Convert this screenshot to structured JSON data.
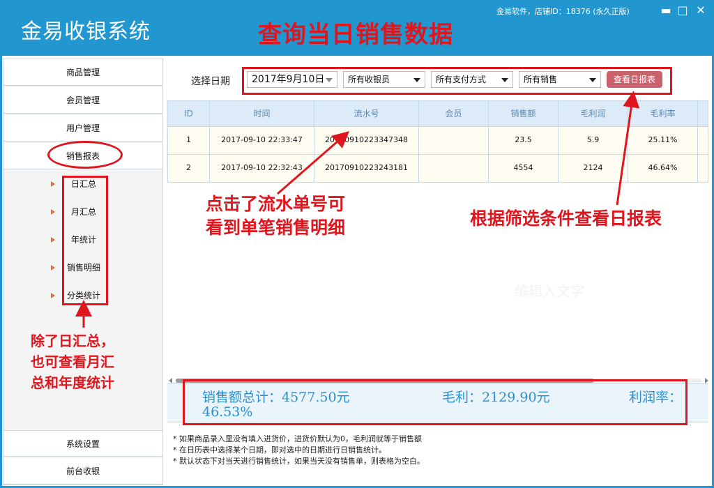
{
  "app": {
    "title": "金易收银系统",
    "store_info": "金易软件，店铺ID：18376 (永久正版)",
    "annotation_title": "查询当日销售数据"
  },
  "window_controls": {
    "minimize": "▬",
    "maximize": "□",
    "close": "✕"
  },
  "sidebar": {
    "top_items": [
      {
        "label": "商品管理"
      },
      {
        "label": "会员管理"
      },
      {
        "label": "用户管理"
      },
      {
        "label": "销售报表"
      }
    ],
    "sub_items": [
      {
        "label": "日汇总"
      },
      {
        "label": "月汇总"
      },
      {
        "label": "年统计"
      },
      {
        "label": "销售明细"
      },
      {
        "label": "分类统计"
      }
    ],
    "bottom_items": [
      {
        "label": "系统设置"
      },
      {
        "label": "前台收银"
      }
    ]
  },
  "filters": {
    "date_label": "选择日期",
    "date": "2017年9月10日",
    "cashier": "所有收银员",
    "payment": "所有支付方式",
    "sales": "所有销售",
    "report_button": "查看日报表"
  },
  "table": {
    "columns": [
      "ID",
      "时间",
      "流水号",
      "会员",
      "销售额",
      "毛利润",
      "毛利率"
    ],
    "rows": [
      {
        "id": "1",
        "time": "2017-09-10 22:33:47",
        "serial": "20170910223347348",
        "member": "",
        "sales": "23.5",
        "profit": "5.9",
        "margin": "25.11%"
      },
      {
        "id": "2",
        "time": "2017-09-10 22:32:43",
        "serial": "20170910223243181",
        "member": "",
        "sales": "4554",
        "profit": "2124",
        "margin": "46.64%"
      }
    ]
  },
  "totals": {
    "sales_total": "销售额总计：4577.50元",
    "profit": "毛利：2129.90元",
    "margin_label": "利润率：",
    "margin_value": "46.53%"
  },
  "notes": [
    "* 如果商品录入里没有填入进货价，进货价默认为0，毛利润就等于销售额",
    "* 在日历表中选择某个日期，即对选中的日期进行日销售统计。",
    "* 默认状态下对当天进行销售统计，如果当天没有销售单，则表格为空白。"
  ],
  "annotations": {
    "serial_hint_line1": "点击了流水单号可",
    "serial_hint_line2": "看到单笔销售明细",
    "filter_hint": "根据筛选条件查看日报表",
    "sidebar_hint_line1": "除了日汇总，",
    "sidebar_hint_line2": "也可查看月汇",
    "sidebar_hint_line3": "总和年度统计",
    "watermark": "编辑入文字"
  },
  "colors": {
    "title_bar": "#2196cf",
    "annotation_red": "#e0161f",
    "report_button": "#c9626c",
    "table_header": "#dcebf7",
    "totals_text": "#2b8fcf"
  }
}
